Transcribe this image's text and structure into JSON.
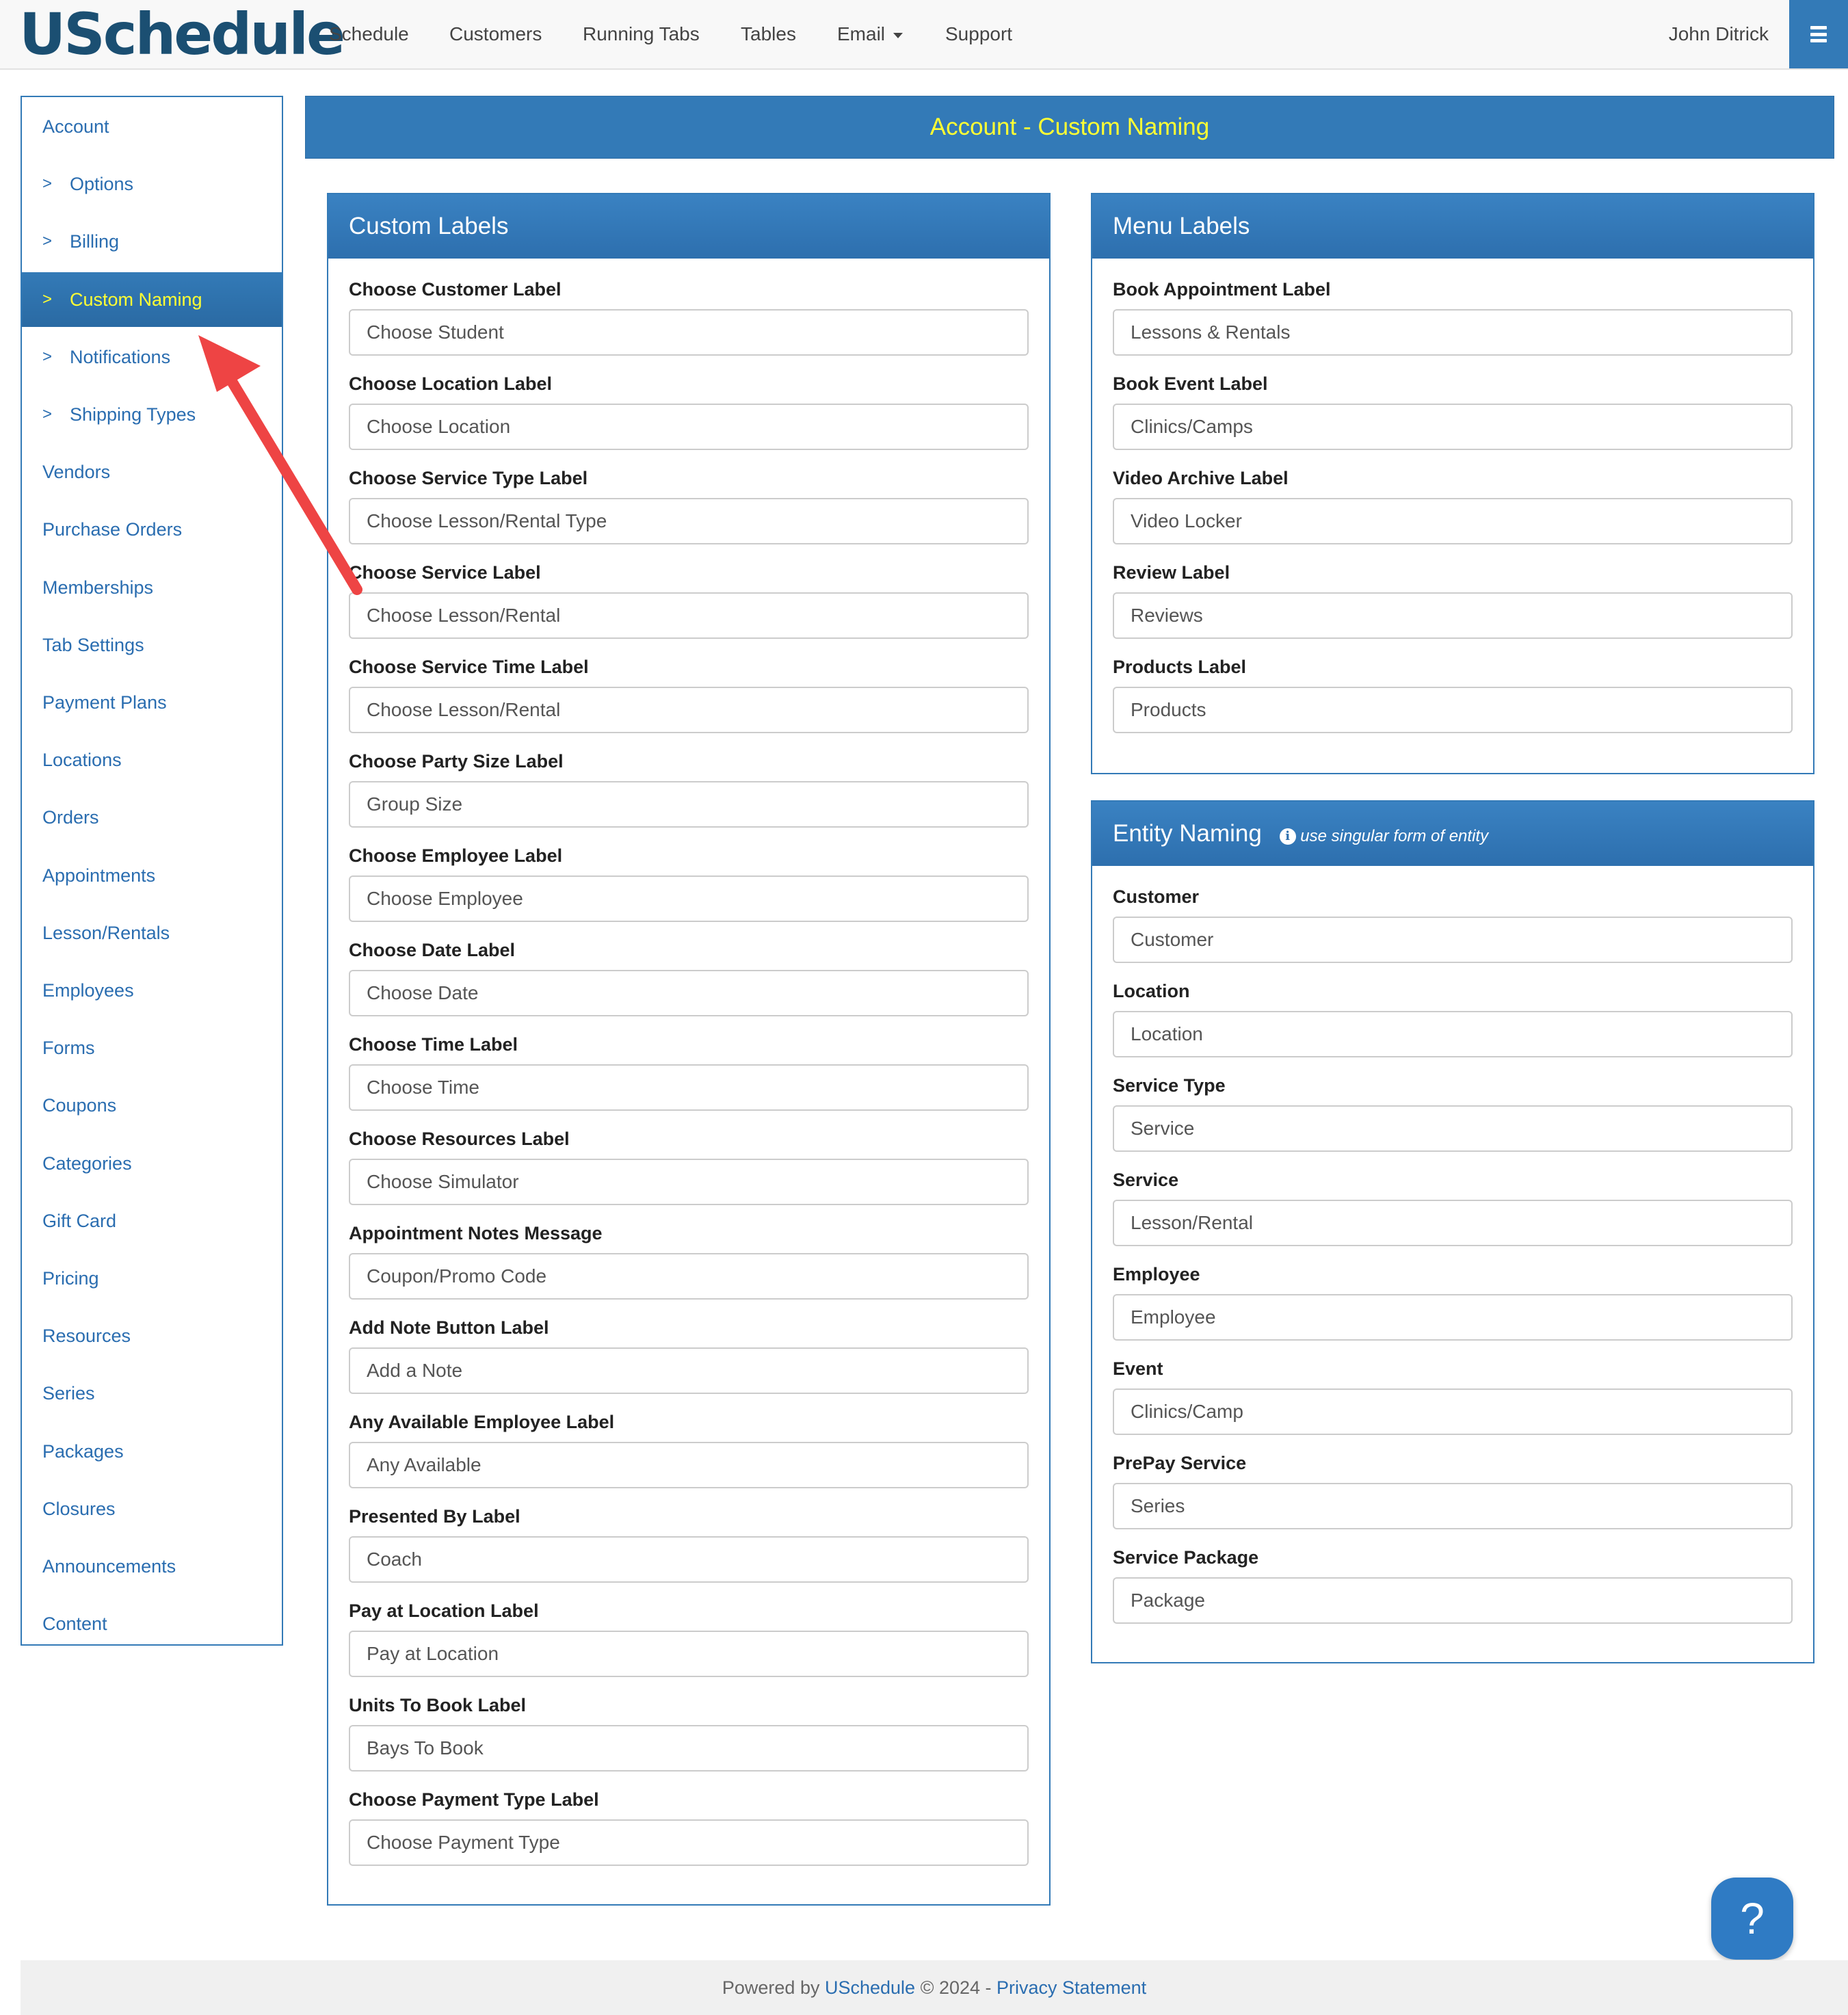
{
  "brand": {
    "logo": "USchedule"
  },
  "nav": {
    "items": [
      "Schedule",
      "Customers",
      "Running Tabs",
      "Tables",
      "Email",
      "Support"
    ],
    "user": "John Ditrick",
    "menu_icon": "hamburger-icon"
  },
  "sidebar": {
    "items": [
      {
        "label": "Account",
        "sub": false
      },
      {
        "label": "Options",
        "sub": true
      },
      {
        "label": "Billing",
        "sub": true
      },
      {
        "label": "Custom Naming",
        "sub": true,
        "active": true
      },
      {
        "label": "Notifications",
        "sub": true
      },
      {
        "label": "Shipping Types",
        "sub": true
      },
      {
        "label": "Vendors",
        "sub": false
      },
      {
        "label": "Purchase Orders",
        "sub": false
      },
      {
        "label": "Memberships",
        "sub": false
      },
      {
        "label": "Tab Settings",
        "sub": false
      },
      {
        "label": "Payment Plans",
        "sub": false
      },
      {
        "label": "Locations",
        "sub": false
      },
      {
        "label": "Orders",
        "sub": false
      },
      {
        "label": "Appointments",
        "sub": false
      },
      {
        "label": "Lesson/Rentals",
        "sub": false
      },
      {
        "label": "Employees",
        "sub": false
      },
      {
        "label": "Forms",
        "sub": false
      },
      {
        "label": "Coupons",
        "sub": false
      },
      {
        "label": "Categories",
        "sub": false
      },
      {
        "label": "Gift Card",
        "sub": false
      },
      {
        "label": "Pricing",
        "sub": false
      },
      {
        "label": "Resources",
        "sub": false
      },
      {
        "label": "Series",
        "sub": false
      },
      {
        "label": "Packages",
        "sub": false
      },
      {
        "label": "Closures",
        "sub": false
      },
      {
        "label": "Announcements",
        "sub": false
      },
      {
        "label": "Content",
        "sub": false
      }
    ],
    "chevron": ">"
  },
  "page": {
    "title": "Account - Custom Naming"
  },
  "custom_labels": {
    "title": "Custom Labels",
    "fields": [
      {
        "label": "Choose Customer Label",
        "value": "Choose Student"
      },
      {
        "label": "Choose Location Label",
        "value": "Choose Location"
      },
      {
        "label": "Choose Service Type Label",
        "value": "Choose Lesson/Rental Type"
      },
      {
        "label": "Choose Service Label",
        "value": "Choose Lesson/Rental"
      },
      {
        "label": "Choose Service Time Label",
        "value": "Choose Lesson/Rental"
      },
      {
        "label": "Choose Party Size Label",
        "value": "Group Size"
      },
      {
        "label": "Choose Employee Label",
        "value": "Choose Employee"
      },
      {
        "label": "Choose Date Label",
        "value": "Choose Date"
      },
      {
        "label": "Choose Time Label",
        "value": "Choose Time"
      },
      {
        "label": "Choose Resources Label",
        "value": "Choose Simulator"
      },
      {
        "label": "Appointment Notes Message",
        "value": "Coupon/Promo Code"
      },
      {
        "label": "Add Note Button Label",
        "value": "Add a Note"
      },
      {
        "label": "Any Available Employee Label",
        "value": "Any Available"
      },
      {
        "label": "Presented By Label",
        "value": "Coach"
      },
      {
        "label": "Pay at Location Label",
        "value": "Pay at Location"
      },
      {
        "label": "Units To Book Label",
        "value": "Bays To Book"
      },
      {
        "label": "Choose Payment Type Label",
        "value": "Choose Payment Type"
      }
    ]
  },
  "menu_labels": {
    "title": "Menu Labels",
    "fields": [
      {
        "label": "Book Appointment Label",
        "value": "Lessons & Rentals"
      },
      {
        "label": "Book Event Label",
        "value": "Clinics/Camps"
      },
      {
        "label": "Video Archive Label",
        "value": "Video Locker"
      },
      {
        "label": "Review Label",
        "value": "Reviews"
      },
      {
        "label": "Products Label",
        "value": "Products"
      }
    ]
  },
  "entity_naming": {
    "title": "Entity Naming",
    "hint": "use singular form of entity",
    "info_icon": "i",
    "fields": [
      {
        "label": "Customer",
        "value": "Customer"
      },
      {
        "label": "Location",
        "value": "Location"
      },
      {
        "label": "Service Type",
        "value": "Service"
      },
      {
        "label": "Service",
        "value": "Lesson/Rental"
      },
      {
        "label": "Employee",
        "value": "Employee"
      },
      {
        "label": "Event",
        "value": "Clinics/Camp"
      },
      {
        "label": "PrePay Service",
        "value": "Series"
      },
      {
        "label": "Service Package",
        "value": "Package"
      }
    ]
  },
  "help": {
    "label": "?"
  },
  "footer": {
    "prefix": "Powered by ",
    "brand": "USchedule",
    "copyright": " © 2024 - ",
    "privacy": "Privacy Statement"
  },
  "colors": {
    "accent": "#337ab7",
    "highlight_text": "#ffff33",
    "arrow": "#ee4444"
  }
}
